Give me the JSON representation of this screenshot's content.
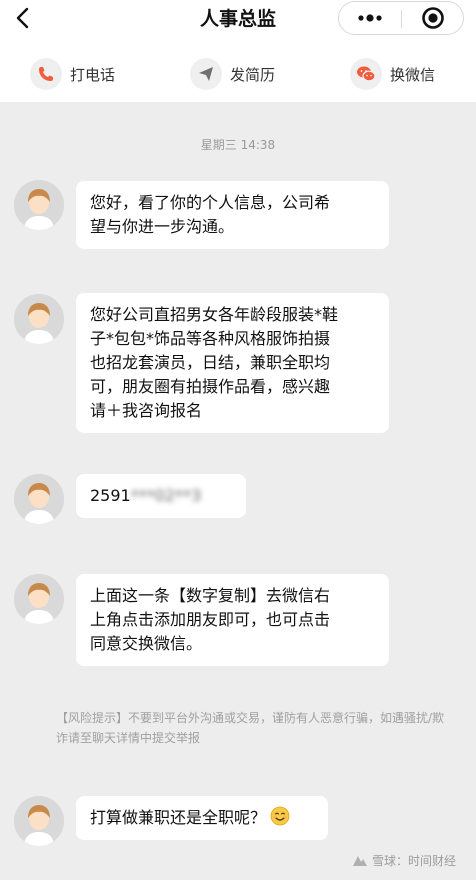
{
  "header": {
    "title": "人事总监",
    "icons": {
      "back": "chevron-left-icon",
      "more": "more-dots-icon",
      "close": "target-close-icon"
    }
  },
  "actions": [
    {
      "label": "打电话",
      "icon": "phone-icon",
      "color": "#f25c3d"
    },
    {
      "label": "发简历",
      "icon": "send-icon",
      "color": "#8a8a8a"
    },
    {
      "label": "换微信",
      "icon": "wechat-icon",
      "color": "#f25c3d"
    }
  ],
  "chat": {
    "timestamp": "星期三 14:38",
    "messages": [
      {
        "lines": [
          "您好，看了你的个人信息，公司希",
          "望与你进一步沟通。"
        ]
      },
      {
        "lines": [
          "您好公司直招男女各年龄段服装*鞋",
          "子*包包*饰品等各种风格服饰拍摄",
          "也招龙套演员，日结，兼职全职均",
          "可，朋友圈有拍摄作品看，感兴趣",
          "请＋我咨询报名"
        ]
      },
      {
        "text_visible": "2591",
        "text_blurred": "***02**3"
      },
      {
        "lines": [
          "上面这一条【数字复制】去微信右",
          "上角点击添加朋友即可，也可点击",
          "同意交换微信。"
        ]
      },
      {
        "text": "打算做兼职还是全职呢？"
      }
    ],
    "risk_notice": "【风险提示】不要到平台外沟通或交易，谨防有人恶意行骗，如遇骚扰/欺诈请至聊天详情中提交举报"
  },
  "watermark": "雪球：时间财经",
  "colors": {
    "background": "#ededed",
    "bubble": "#ffffff",
    "accent": "#f25c3d"
  }
}
